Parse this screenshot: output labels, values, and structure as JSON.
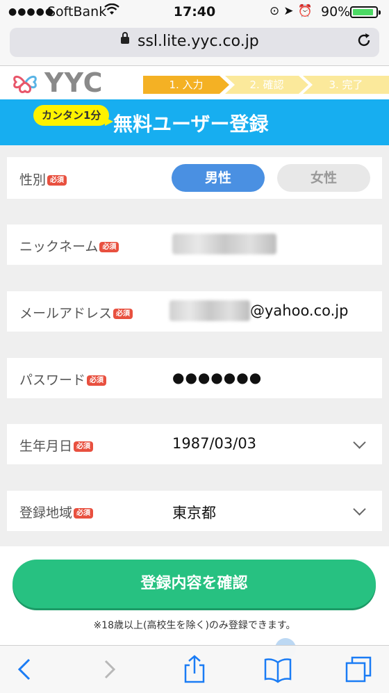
{
  "status": {
    "signal": "●●●●●",
    "carrier": "SoftBank",
    "time": "17:40",
    "battery": "90%",
    "battery_level": 0.9
  },
  "browser": {
    "url": "ssl.lite.yyc.co.jp"
  },
  "header": {
    "logo": "YYC",
    "steps": [
      "1. 入力",
      "2. 確認",
      "3. 完了"
    ]
  },
  "banner": {
    "bubble": "カンタン1分",
    "title": "無料ユーザー登録"
  },
  "form": {
    "required_badge": "必須",
    "gender": {
      "label": "性別",
      "male": "男性",
      "female": "女性",
      "selected": "男性"
    },
    "nickname": {
      "label": "ニックネーム"
    },
    "email": {
      "label": "メールアドレス",
      "domain": "@yahoo.co.jp"
    },
    "password": {
      "label": "パスワード",
      "value": "●●●●●●●"
    },
    "birthday": {
      "label": "生年月日",
      "value": "1987/03/03"
    },
    "region": {
      "label": "登録地域",
      "value": "東京都"
    },
    "confirm_button": "登録内容を確認",
    "note": "※18歳以上(高校生を除く)のみ登録できます。"
  },
  "colors": {
    "accent_blue": "#17aef0",
    "male_button": "#4a90e2",
    "confirm_green": "#27c181",
    "step_active": "#f4b124",
    "step_inactive": "#fbe99b",
    "required_red": "#e8503f"
  }
}
